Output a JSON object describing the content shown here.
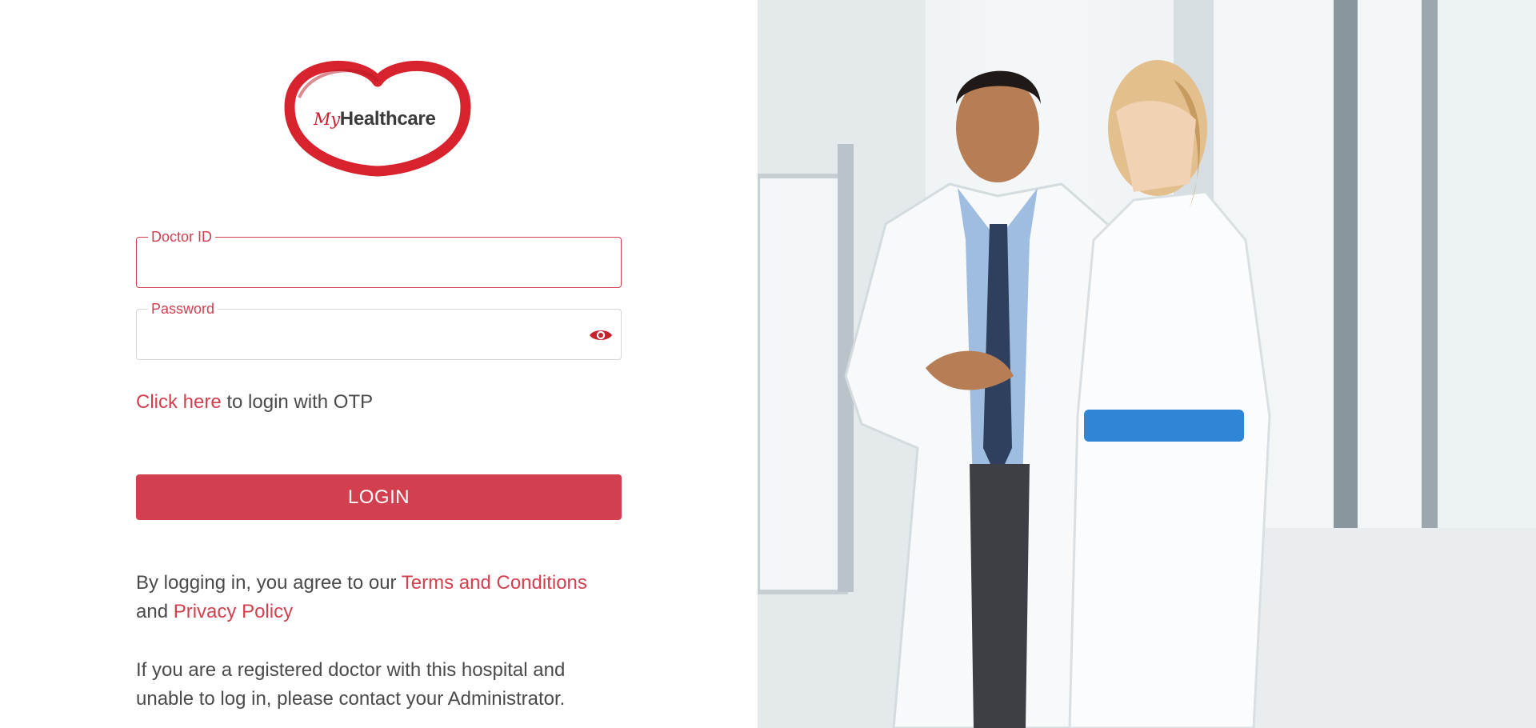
{
  "brand": {
    "my": "My",
    "name": "Healthcare"
  },
  "form": {
    "doctor_id_label": "Doctor ID",
    "doctor_id_value": "",
    "password_label": "Password",
    "password_value": "",
    "otp_link": "Click here",
    "otp_text": " to login with OTP",
    "login_label": "LOGIN"
  },
  "terms": {
    "prefix": "By logging in, you agree to our ",
    "terms_link": "Terms and Conditions",
    "and": "and ",
    "privacy_link": "Privacy Policy"
  },
  "help_text": "If you are a registered doctor with this hospital and unable to log in, please contact your Administrator.",
  "colors": {
    "accent": "#d2404f",
    "text": "#4a4a4a"
  },
  "icons": {
    "password_toggle": "eye-icon"
  }
}
